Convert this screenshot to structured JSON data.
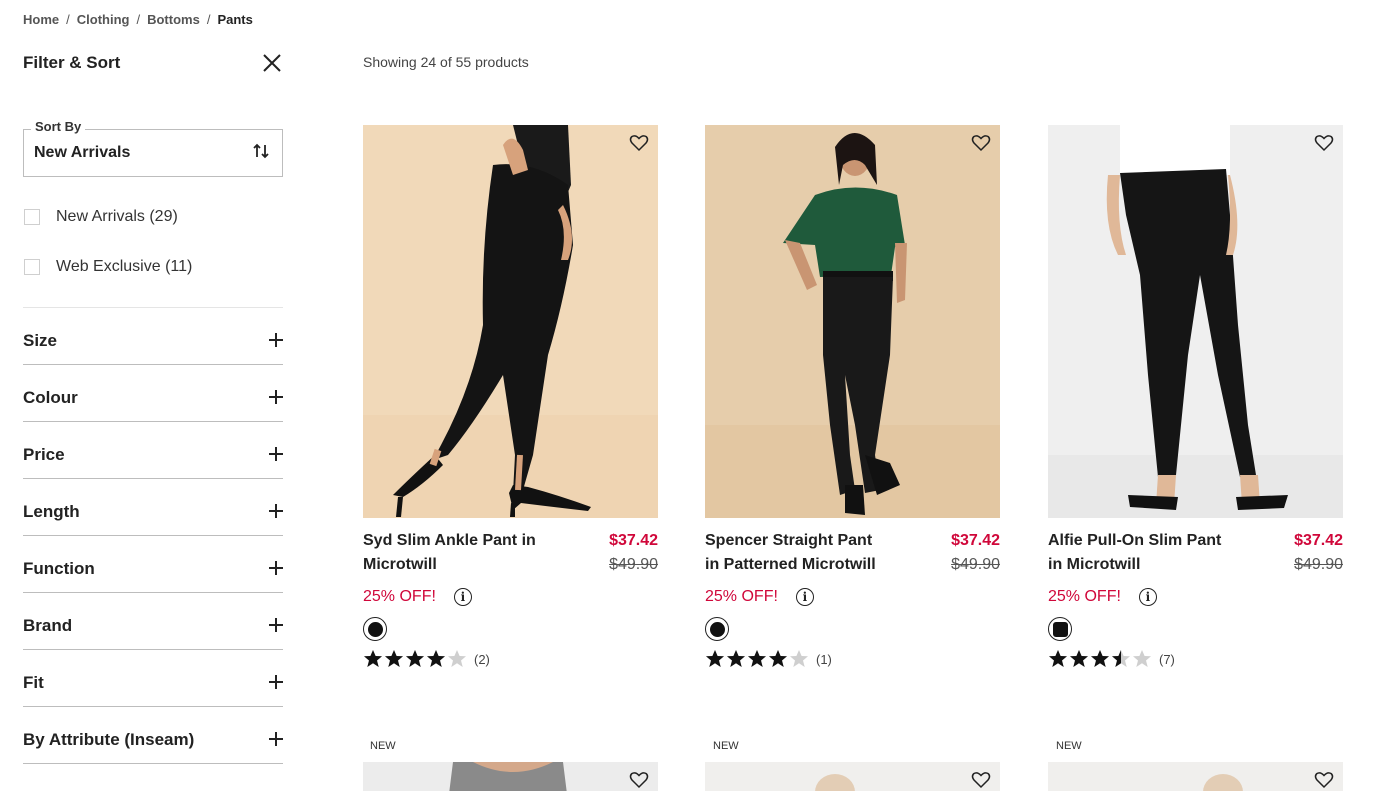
{
  "breadcrumb": [
    "Home",
    "Clothing",
    "Bottoms",
    "Pants"
  ],
  "filter": {
    "title": "Filter & Sort",
    "sort_label": "Sort By",
    "sort_value": "New Arrivals",
    "checks": [
      {
        "label": "New Arrivals (29)"
      },
      {
        "label": "Web Exclusive (11)"
      }
    ],
    "sections": [
      "Size",
      "Colour",
      "Price",
      "Length",
      "Function",
      "Brand",
      "Fit",
      "By Attribute (Inseam)"
    ]
  },
  "showing": "Showing 24 of 55 products",
  "products": [
    {
      "name": "Syd Slim Ankle Pant in Microtwill",
      "price": "$37.42",
      "original": "$49.90",
      "discount": "25% OFF!",
      "rating": 4,
      "reviews": "(2)",
      "swatch": "#111111"
    },
    {
      "name": "Spencer Straight Pant in Patterned Microtwill",
      "price": "$37.42",
      "original": "$49.90",
      "discount": "25% OFF!",
      "rating": 4,
      "reviews": "(1)",
      "swatch": "#111111"
    },
    {
      "name": "Alfie Pull-On Slim Pant in Microtwill",
      "price": "$37.42",
      "original": "$49.90",
      "discount": "25% OFF!",
      "rating": 3.5,
      "reviews": "(7)",
      "swatch": "#111111"
    }
  ],
  "next_row_tags": [
    "NEW",
    "NEW",
    "NEW"
  ],
  "colors": {
    "sale": "#d0073a",
    "text": "#222222"
  },
  "icons": {
    "close": "close-icon",
    "sort": "sort-arrows-icon",
    "heart": "heart-icon",
    "info": "info-icon",
    "star": "star-icon"
  }
}
